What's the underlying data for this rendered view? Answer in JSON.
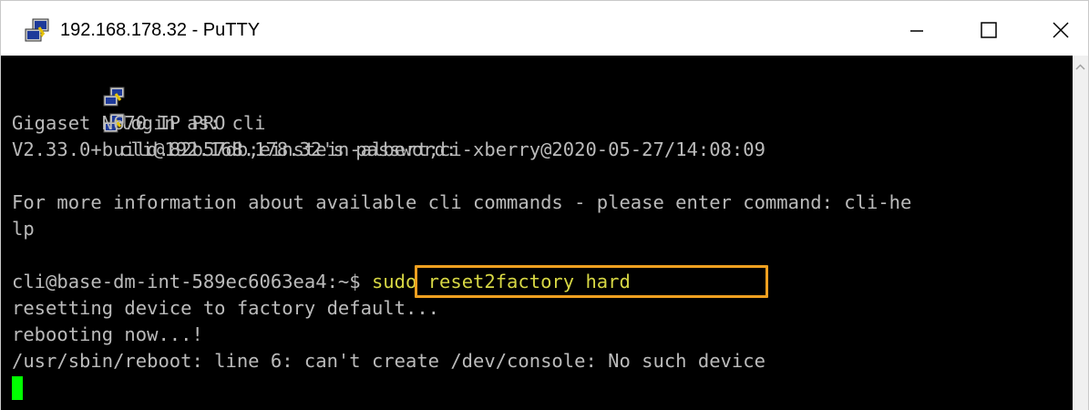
{
  "window": {
    "title": "192.168.178.32 - PuTTY",
    "icon": "putty-icon",
    "buttons": {
      "minimize": "minimize-icon",
      "maximize": "maximize-icon",
      "close": "close-icon"
    }
  },
  "terminal": {
    "lines": [
      "login as: cli",
      "cli@192.168.178.32's password:",
      "Gigaset N670 IP PRO",
      "V2.33.0+build.82b57db;einstein-albert;ci-xberry@2020-05-27/14:08:09",
      "For more information about available cli commands - please enter command: cli-he",
      "lp",
      "cli@base-dm-int-589ec6063ea4:~$",
      " sudo reset2factory hard",
      "resetting device to factory default...",
      "rebooting now...!",
      "/usr/sbin/reboot: line 6: can't create /dev/console: No such device"
    ]
  },
  "colors": {
    "terminal_bg": "#000000",
    "terminal_fg": "#bbbbbb",
    "command": "#d7d744",
    "highlight_border": "#f0a020",
    "cursor": "#00ff00"
  }
}
